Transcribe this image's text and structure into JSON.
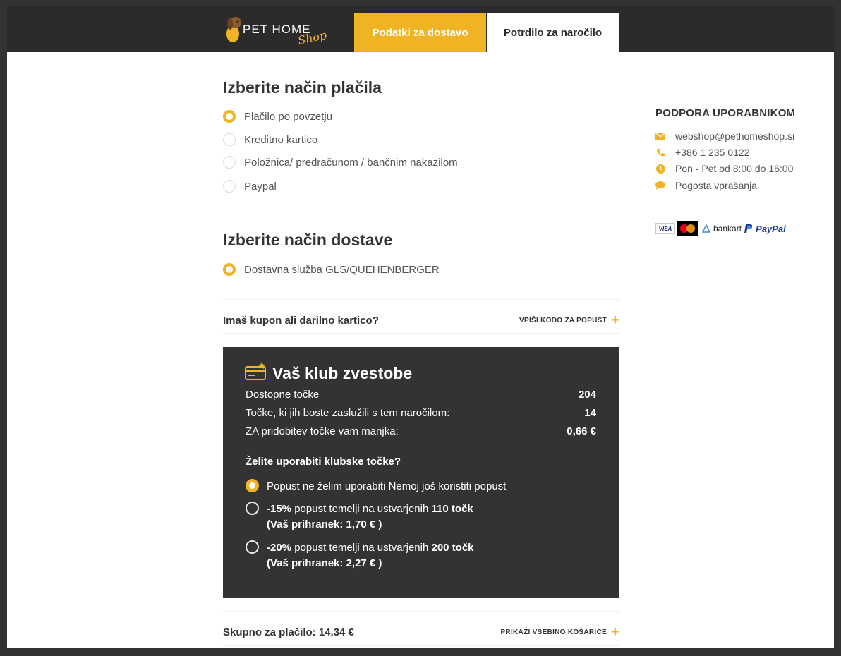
{
  "header": {
    "logo_text": "PET HOME",
    "logo_script": "Shop",
    "tabs": [
      {
        "label": "Podatki za dostavo"
      },
      {
        "label": "Potrdilo za naročilo"
      }
    ]
  },
  "payment": {
    "title": "Izberite način plačila",
    "options": [
      {
        "label": "Plačilo po povzetju",
        "selected": true
      },
      {
        "label": "Kreditno kartico",
        "selected": false
      },
      {
        "label": "Položnica/ predračunom / bančnim nakazilom",
        "selected": false
      },
      {
        "label": "Paypal",
        "selected": false
      }
    ]
  },
  "shipping": {
    "title": "Izberite način dostave",
    "options": [
      {
        "label": "Dostavna služba GLS/QUEHENBERGER",
        "selected": true
      }
    ]
  },
  "coupon": {
    "question": "Imaš kupon ali darilno kartico?",
    "action": "VPIŠI KODO ZA POPUST"
  },
  "club": {
    "title": "Vaš klub zvestobe",
    "stats": [
      {
        "label": "Dostopne točke",
        "value": "204"
      },
      {
        "label": "Točke, ki jih boste zaslužili s tem naročilom:",
        "value": "14"
      },
      {
        "label": "ZA pridobitev točke vam manjka:",
        "value": "0,66 €"
      }
    ],
    "question": "Želite uporabiti klubske točke?",
    "options": [
      {
        "text": "Popust ne želim uporabiti Nemoj još koristiti popust",
        "selected": true
      },
      {
        "pct": "-15%",
        "mid": " popust temelji na ustvarjenih ",
        "pts": "110 točk",
        "saving": "(Vaš prihranek: 1,70 € )",
        "selected": false
      },
      {
        "pct": "-20%",
        "mid": " popust temelji na ustvarjenih ",
        "pts": "200 točk",
        "saving": "(Vaš prihranek: 2,27 € )",
        "selected": false
      }
    ]
  },
  "total": {
    "label": "Skupno za plačilo: 14,34 €",
    "action": "PRIKAŽI VSEBINO KOŠARICE"
  },
  "support": {
    "title": "PODPORA UPORABNIKOM",
    "items": [
      {
        "icon": "envelope-icon",
        "text": "webshop@pethomeshop.si"
      },
      {
        "icon": "phone-icon",
        "text": "+386 1 235 0122"
      },
      {
        "icon": "clock-icon",
        "text": "Pon - Pet od 8:00 do 16:00"
      },
      {
        "icon": "chat-icon",
        "text": "Pogosta vprašanja"
      }
    ],
    "payment_logos": {
      "visa": "VISA",
      "bankart": "bankart",
      "paypal": "PayPal"
    }
  },
  "colors": {
    "accent": "#f0b323",
    "dark": "#2b2b2b",
    "panel": "#333333"
  }
}
